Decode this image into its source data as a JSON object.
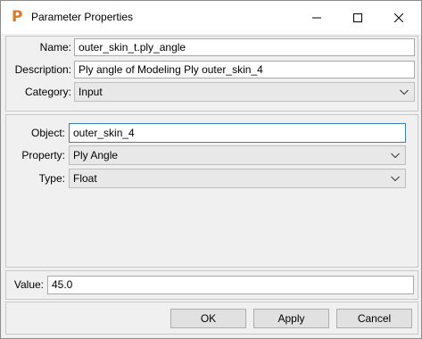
{
  "window": {
    "title": "Parameter Properties",
    "app_icon_glyph": "P",
    "accent_color": "#e07a1f"
  },
  "form": {
    "name_label": "Name:",
    "name_value": "outer_skin_t.ply_angle",
    "description_label": "Description:",
    "description_value": "Ply angle of Modeling Ply outer_skin_4",
    "category_label": "Category:",
    "category_value": "Input"
  },
  "object_section": {
    "object_label": "Object:",
    "object_value": "outer_skin_4",
    "property_label": "Property:",
    "property_value": "Ply Angle",
    "type_label": "Type:",
    "type_value": "Float"
  },
  "value_section": {
    "value_label": "Value:",
    "value_value": "45.0"
  },
  "buttons": {
    "ok": "OK",
    "apply": "Apply",
    "cancel": "Cancel"
  }
}
